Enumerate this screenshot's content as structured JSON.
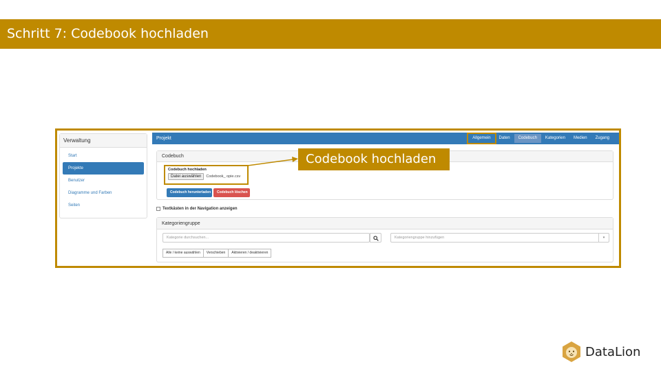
{
  "slide": {
    "title": "Schritt 7: Codebook hochladen",
    "callout": "Codebook hochladen",
    "accent_color": "#bf8a00"
  },
  "sidebar": {
    "heading": "Verwaltung",
    "items": [
      {
        "label": "Start",
        "active": false
      },
      {
        "label": "Projekte",
        "active": true
      },
      {
        "label": "Benutzer",
        "active": false
      },
      {
        "label": "Diagramme und Farben",
        "active": false
      },
      {
        "label": "Seiten",
        "active": false
      }
    ]
  },
  "navbar": {
    "brand": "Projekt",
    "tabs": [
      {
        "label": "Allgemein",
        "highlighted": true
      },
      {
        "label": "Daten"
      },
      {
        "label": "Codebuch",
        "active": true
      },
      {
        "label": "Kategorien"
      },
      {
        "label": "Medien"
      },
      {
        "label": "Zugang"
      }
    ]
  },
  "codebuch_panel": {
    "heading": "Codebuch",
    "upload_label": "Codebuch hochladen",
    "file_button": "Datei auswählen",
    "file_name": "Codebook_ opie.csv",
    "download_button": "Codebuch herunterladen",
    "delete_button": "Codebuch löschen"
  },
  "checkbox": {
    "label": "Textkästen in der Navigation anzeigen"
  },
  "kategorien_panel": {
    "heading": "Kategoriengruppe",
    "search_placeholder": "Kategorie durchsuchen...",
    "select_placeholder": "Kategoriengruppe hinzufügen",
    "buttons": [
      "Alle / keine auswählen",
      "Verschieben",
      "Aktivieren / deaktivieren"
    ]
  },
  "logo": {
    "text": "DataLion"
  },
  "icons": {
    "search": "search-icon",
    "caret": "caret-down-icon",
    "logo": "lion-icon"
  }
}
